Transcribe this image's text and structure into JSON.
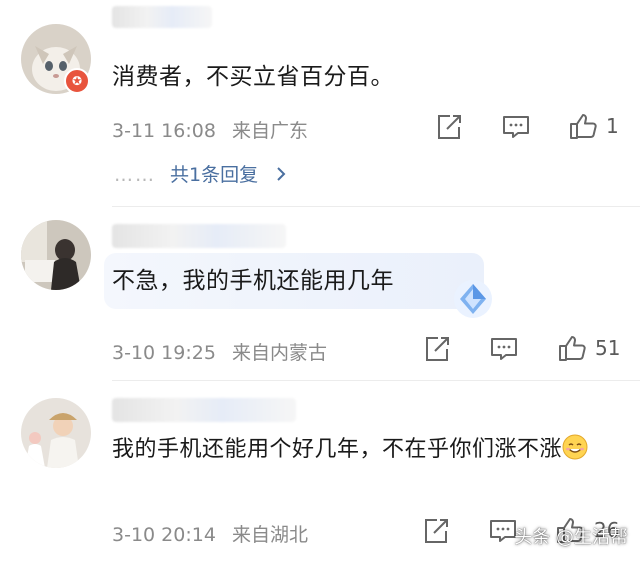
{
  "comments": [
    {
      "text": "消费者，不买立省百分百。",
      "date": "3-11 16:08",
      "location": "来自广东",
      "likes": "1",
      "replies": "共1条回复",
      "reply_dots": "……",
      "badge_icon": "✪"
    },
    {
      "text": "不急，我的手机还能用几年",
      "date": "3-10 19:25",
      "location": "来自内蒙古",
      "likes": "51"
    },
    {
      "text": "我的手机还能用个好几年，不在乎你们涨不涨",
      "date": "3-10 20:14",
      "location": "来自湖北",
      "likes": "26"
    }
  ],
  "icons": {
    "share": "share-icon",
    "comment": "comment-icon",
    "like": "thumbs-up-icon",
    "chevron": "chevron-right-icon"
  },
  "colors": {
    "reply_link": "#4a6fa0",
    "meta": "#8a8a8a",
    "badge": "#e8543d"
  },
  "watermark": "头条 @生活帮"
}
